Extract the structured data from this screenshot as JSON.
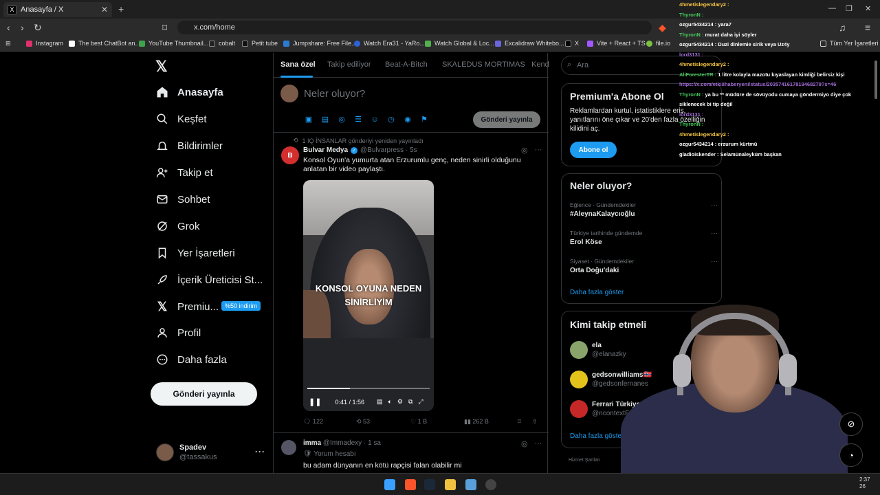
{
  "browser": {
    "tab_title": "Anasayfa / X",
    "tab_close": "✕",
    "new_tab": "+",
    "url": "x.com/home",
    "bookmarks": [
      {
        "label": "Instagram",
        "color": "#e1306c"
      },
      {
        "label": "The best ChatBot an...",
        "color": "#ffffff"
      },
      {
        "label": "YouTube Thumbnail...",
        "color": "#3fa34d"
      },
      {
        "label": "cobalt",
        "color": "#222222"
      },
      {
        "label": "Petit tube",
        "color": "#111111"
      },
      {
        "label": "Jumpshare: Free File...",
        "color": "#2b7bd3"
      },
      {
        "label": "Watch Era31 - YaRo...",
        "color": "#2d62d8"
      },
      {
        "label": "Watch Global & Loc...",
        "color": "#53b04f"
      },
      {
        "label": "Excalidraw Whitebo...",
        "color": "#6965db"
      },
      {
        "label": "X",
        "color": "#000000"
      },
      {
        "label": "Vite + React + TS",
        "color": "#a259ff"
      },
      {
        "label": "file.io",
        "color": "#7ac142"
      }
    ],
    "all_bookmarks": "Tüm Yer İşaretleri"
  },
  "nav": {
    "items": [
      {
        "label": "Anasayfa",
        "icon": "home-icon"
      },
      {
        "label": "Keşfet",
        "icon": "search-icon"
      },
      {
        "label": "Bildirimler",
        "icon": "bell-icon"
      },
      {
        "label": "Takip et",
        "icon": "add-user-icon"
      },
      {
        "label": "Sohbet",
        "icon": "mail-icon"
      },
      {
        "label": "Grok",
        "icon": "grok-icon"
      },
      {
        "label": "Yer İşaretleri",
        "icon": "bookmark-icon"
      },
      {
        "label": "İçerik Üreticisi St...",
        "icon": "rocket-icon"
      },
      {
        "label": "Premiu...",
        "icon": "x-logo-icon"
      },
      {
        "label": "Profil",
        "icon": "profile-icon"
      },
      {
        "label": "Daha fazla",
        "icon": "more-circle-icon"
      }
    ],
    "premium_badge": "%50 indirim",
    "post_button": "Gönderi yayınla"
  },
  "account": {
    "name": "Spadev",
    "handle": "@tassakus"
  },
  "feed": {
    "tabs": [
      "Sana özel",
      "Takip ediliyor",
      "Beat-A-Bitch",
      "SKALEDUS MORTIMAS",
      "Kend"
    ],
    "compose_placeholder": "Neler oluyor?",
    "publish_button": "Gönderi yayınla",
    "post1": {
      "repost_line": "1 IQ İNSANLAR gönderiyi yeniden yayınladı",
      "name": "Bulvar Medya",
      "handle": "@Bulvarpress",
      "time": "· 5s",
      "text": "Konsol Oyun'a yumurta atan Erzurumlu genç, neden sinirli olduğunu anlatan bir video paylaştı.",
      "video_caption_1": "KONSOL OYUNA NEDEN",
      "video_caption_2": "SİNİRLİYİM",
      "video_time": "0:41 / 1:56",
      "video_progress": 0.35,
      "replies": "122",
      "reposts": "53",
      "likes": "1 B",
      "views": "262 B"
    },
    "post2": {
      "name": "imma",
      "handle": "@Immadexy",
      "time": "· 1 sa",
      "sub": "Yorum hesabı",
      "text": "bu adam dünyanın en kötü rapçisi falan olabilir mi"
    }
  },
  "sidebar": {
    "search_placeholder": "Ara",
    "premium": {
      "title": "Premium'a Abone Ol",
      "desc": "Reklamlardan kurtul, istatistiklere eriş, yanıtlarını öne çıkar ve 20'den fazla özelliğin kilidini aç.",
      "button": "Abone ol"
    },
    "trends_title": "Neler oluyor?",
    "trends": [
      {
        "category": "Eğlence · Gündemdekiler",
        "name": "#AleynaKalaycıoğlu"
      },
      {
        "category": "Türkiye tarihinde gündemde",
        "name": "Erol Köse"
      },
      {
        "category": "Siyaset · Gündemdekiler",
        "name": "Orta Doğu'daki"
      }
    ],
    "show_more": "Daha fazla göster",
    "who_title": "Kimi takip etmeli",
    "who": [
      {
        "name": "ela",
        "handle": "@elanazky",
        "color": "#8aa36b"
      },
      {
        "name": "gedsonwilliams🇳🇴",
        "handle": "@gedsonfernanes",
        "color": "#e3c21b"
      },
      {
        "name": "Ferrari Türkiye",
        "handle": "@ncontextFe",
        "color": "#c62828"
      }
    ],
    "who_more": "Daha fazla göste",
    "footer": "Hizmet Şartları"
  },
  "chat": [
    {
      "user": "4hmetislegendary2 :",
      "msg": "",
      "color": "#f5c542"
    },
    {
      "user": "ThyronN :",
      "msg": "",
      "color": "#49c95c"
    },
    {
      "user": "ozgur5434214 :",
      "msg": "yara7",
      "color": "#ffffff"
    },
    {
      "user": "ThyronN :",
      "msg": "murat daha iyi söyler",
      "color": "#49c95c"
    },
    {
      "user": "ozgur5434214 :",
      "msg": "Duzi dinlemie sirik veya Uz4y",
      "color": "#ffffff"
    },
    {
      "user": "lord3131 :",
      "msg": "",
      "color": "#a06cd5"
    },
    {
      "user": "4hmetislegendary2 :",
      "msg": "",
      "color": "#f5c542"
    },
    {
      "user": "AliForesterTR :",
      "msg": "1 litre kolayla mazotu kıyaslayan kimliği belirsiz kişi",
      "color": "#49c95c"
    },
    {
      "user": "",
      "msg": "https://x.com/etkiiihaberyeni/status/2035741617819468279?s=46",
      "color": "#a06cd5"
    },
    {
      "user": "ThyronN :",
      "msg": "ya bu ** müdüre de sövüyodu cumaya göndermiyo diye çok",
      "color": "#49c95c"
    },
    {
      "user": "",
      "msg": "siklenecek bi tip değil",
      "color": "#ffffff"
    },
    {
      "user": "lord3131 :",
      "msg": "",
      "color": "#a06cd5"
    },
    {
      "user": "ThyronN :",
      "msg": "",
      "color": "#49c95c"
    },
    {
      "user": "4hmetislegendary2 :",
      "msg": "",
      "color": "#f5c542"
    },
    {
      "user": "ozgur5434214 :",
      "msg": "erzurum kürtmü",
      "color": "#ffffff"
    },
    {
      "user": "gladioiskender :",
      "msg": "Selamünaleyküm başkan",
      "color": "#ffffff"
    }
  ],
  "clock": {
    "time": "2:37",
    "date": "26"
  }
}
